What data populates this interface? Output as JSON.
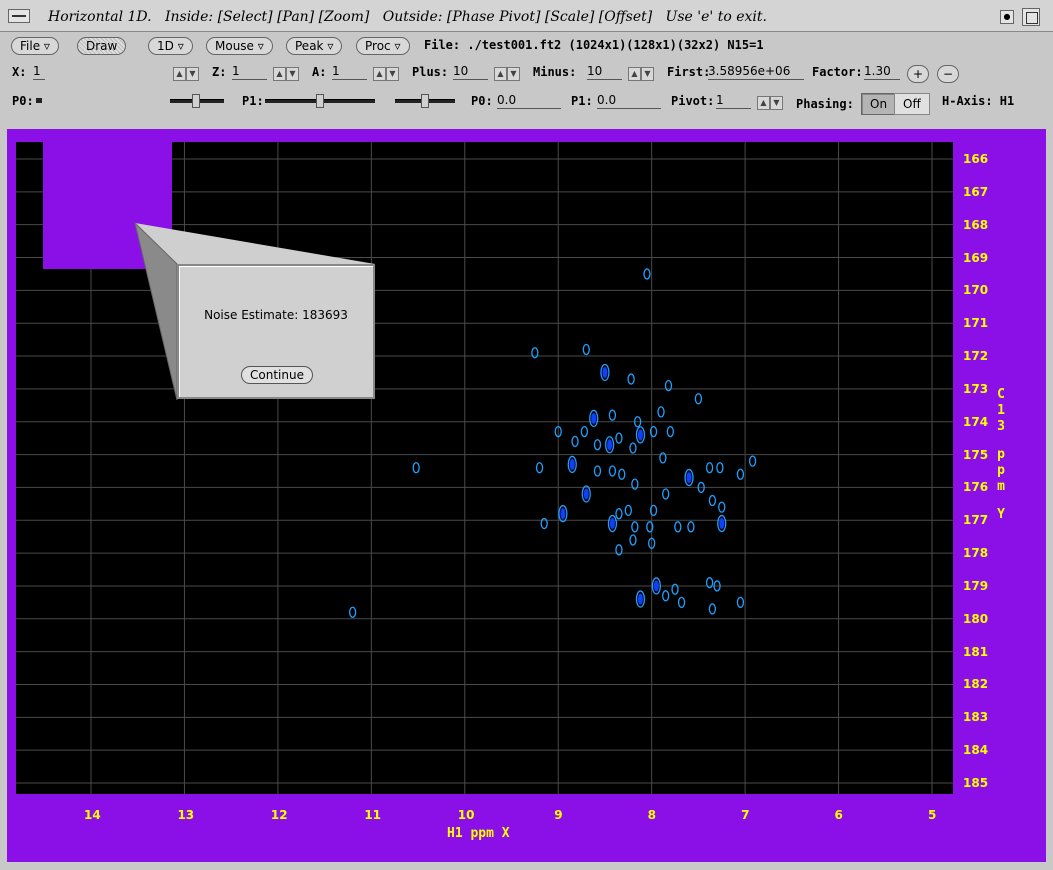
{
  "window": {
    "title": "Horizontal 1D.   Inside: [Select] [Pan] [Zoom]   Outside: [Phase Pivot] [Scale] [Offset]   Use 'e' to exit."
  },
  "menus": [
    {
      "label": "File"
    },
    {
      "label": "Draw"
    },
    {
      "label": "1D"
    },
    {
      "label": "Mouse"
    },
    {
      "label": "Peak"
    },
    {
      "label": "Proc"
    }
  ],
  "file_info": "File: ./test001.ft2 (1024x1)(128x1)(32x2) N15=1",
  "row2": {
    "x_label": "X:",
    "x_value": "1",
    "z_label": "Z:",
    "z_value": "1",
    "a_label": "A:",
    "a_value": "1",
    "plus_label": "Plus:",
    "plus_value": "10",
    "minus_label": "Minus:",
    "minus_value": "10",
    "first_label": "First:",
    "first_value": "3.58956e+06",
    "factor_label": "Factor:",
    "factor_value": "1.30",
    "plus_btn": "+",
    "minus_btn": "−"
  },
  "row3": {
    "p0_label": "P0:",
    "p1_label": "P1:",
    "p0_field_label": "P0:",
    "p0_value": "0.0",
    "p1_field_label": "P1:",
    "p1_value": "0.0",
    "pivot_label": "Pivot:",
    "pivot_value": "1",
    "phasing_label": "Phasing:",
    "on_label": "On",
    "off_label": "Off",
    "haxis_label": "H-Axis: H1"
  },
  "colors": {
    "background": "#8b10e8",
    "plot": "#000000",
    "axis_text": "#ffff00",
    "contour": "#1ea0ff",
    "contour_core": "#1040ff"
  },
  "chart_data": {
    "type": "scatter",
    "xlabel": "H1 ppm X",
    "ylabel": "C13 ppm Y",
    "x_ticks": [
      "14",
      "13",
      "12",
      "11",
      "10",
      "9",
      "8",
      "7",
      "6",
      "5"
    ],
    "y_ticks": [
      "166",
      "167",
      "168",
      "169",
      "170",
      "171",
      "172",
      "173",
      "174",
      "175",
      "176",
      "177",
      "178",
      "179",
      "180",
      "181",
      "182",
      "183",
      "184",
      "185"
    ],
    "xlim": [
      14.8,
      4.8
    ],
    "ylim": [
      165.6,
      185.5
    ],
    "grid": true,
    "peaks": [
      {
        "x": 8.05,
        "y": 169.5
      },
      {
        "x": 9.25,
        "y": 171.9
      },
      {
        "x": 8.7,
        "y": 171.8
      },
      {
        "x": 8.5,
        "y": 172.5
      },
      {
        "x": 8.22,
        "y": 172.7
      },
      {
        "x": 7.82,
        "y": 172.9
      },
      {
        "x": 7.5,
        "y": 173.3
      },
      {
        "x": 8.42,
        "y": 173.8
      },
      {
        "x": 8.62,
        "y": 173.9
      },
      {
        "x": 8.15,
        "y": 174.0
      },
      {
        "x": 7.9,
        "y": 173.7
      },
      {
        "x": 9.0,
        "y": 174.3
      },
      {
        "x": 8.72,
        "y": 174.3
      },
      {
        "x": 8.12,
        "y": 174.4
      },
      {
        "x": 7.98,
        "y": 174.3
      },
      {
        "x": 7.8,
        "y": 174.3
      },
      {
        "x": 8.82,
        "y": 174.6
      },
      {
        "x": 8.58,
        "y": 174.7
      },
      {
        "x": 8.45,
        "y": 174.7
      },
      {
        "x": 8.35,
        "y": 174.5
      },
      {
        "x": 8.2,
        "y": 174.8
      },
      {
        "x": 7.88,
        "y": 175.1
      },
      {
        "x": 9.2,
        "y": 175.4
      },
      {
        "x": 8.85,
        "y": 175.3
      },
      {
        "x": 8.58,
        "y": 175.5
      },
      {
        "x": 8.42,
        "y": 175.5
      },
      {
        "x": 8.32,
        "y": 175.6
      },
      {
        "x": 8.18,
        "y": 175.9
      },
      {
        "x": 7.6,
        "y": 175.7
      },
      {
        "x": 7.38,
        "y": 175.4
      },
      {
        "x": 7.27,
        "y": 175.4
      },
      {
        "x": 7.05,
        "y": 175.6
      },
      {
        "x": 6.92,
        "y": 175.2
      },
      {
        "x": 8.7,
        "y": 176.2
      },
      {
        "x": 7.85,
        "y": 176.2
      },
      {
        "x": 7.47,
        "y": 176.0
      },
      {
        "x": 7.35,
        "y": 176.4
      },
      {
        "x": 7.25,
        "y": 176.6
      },
      {
        "x": 8.95,
        "y": 176.8
      },
      {
        "x": 8.35,
        "y": 176.8
      },
      {
        "x": 8.25,
        "y": 176.7
      },
      {
        "x": 7.98,
        "y": 176.7
      },
      {
        "x": 9.15,
        "y": 177.1
      },
      {
        "x": 8.42,
        "y": 177.1
      },
      {
        "x": 8.18,
        "y": 177.2
      },
      {
        "x": 8.02,
        "y": 177.2
      },
      {
        "x": 7.72,
        "y": 177.2
      },
      {
        "x": 7.58,
        "y": 177.2
      },
      {
        "x": 7.25,
        "y": 177.1
      },
      {
        "x": 8.2,
        "y": 177.6
      },
      {
        "x": 8.0,
        "y": 177.7
      },
      {
        "x": 8.35,
        "y": 177.9
      },
      {
        "x": 7.38,
        "y": 178.9
      },
      {
        "x": 7.95,
        "y": 179.0
      },
      {
        "x": 7.75,
        "y": 179.1
      },
      {
        "x": 7.3,
        "y": 179.0
      },
      {
        "x": 7.68,
        "y": 179.5
      },
      {
        "x": 7.85,
        "y": 179.3
      },
      {
        "x": 8.12,
        "y": 179.4
      },
      {
        "x": 7.05,
        "y": 179.5
      },
      {
        "x": 7.35,
        "y": 179.7
      },
      {
        "x": 10.52,
        "y": 175.4
      },
      {
        "x": 11.2,
        "y": 179.8
      }
    ]
  },
  "dialog": {
    "message": "Noise Estimate: 183693",
    "button": "Continue"
  }
}
